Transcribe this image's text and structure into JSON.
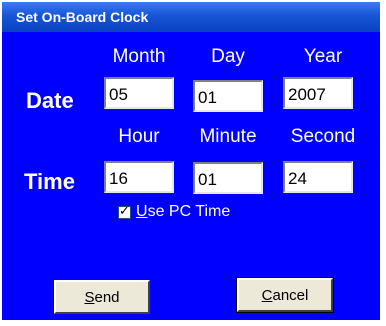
{
  "window": {
    "title": "Set On-Board Clock"
  },
  "columns": {
    "month": "Month",
    "day": "Day",
    "year": "Year",
    "hour": "Hour",
    "minute": "Minute",
    "second": "Second"
  },
  "rows": {
    "date": "Date",
    "time": "Time"
  },
  "fields": {
    "month": "05",
    "day": "01",
    "year": "2007",
    "hour": "16",
    "minute": "01",
    "second": "24"
  },
  "use_pc_time": {
    "label": "Use PC Time",
    "checked": true
  },
  "buttons": {
    "send": "Send",
    "cancel": "Cancel"
  },
  "colors": {
    "client_bg": "#0000ff",
    "title_bg": "#0a43c3",
    "label_text": "#ffffff"
  }
}
